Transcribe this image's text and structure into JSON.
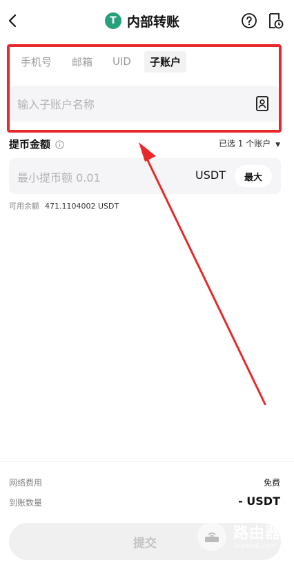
{
  "header": {
    "title": "内部转账",
    "coin_symbol": "T"
  },
  "tabs": [
    {
      "label": "手机号",
      "active": false
    },
    {
      "label": "邮箱",
      "active": false
    },
    {
      "label": "UID",
      "active": false
    },
    {
      "label": "子账户",
      "active": true
    }
  ],
  "subaccount_input": {
    "placeholder": "输入子账户名称"
  },
  "amount": {
    "label": "提币金额",
    "selected_text": "已选 1 个账户",
    "placeholder": "最小提币额 0.01",
    "unit": "USDT",
    "max_label": "最大",
    "available_label": "可用余额",
    "available_value": "471.1104002 USDT"
  },
  "footer": {
    "fee_label": "网络费用",
    "fee_value": "免费",
    "receive_label": "到账数量",
    "receive_value": "- USDT",
    "submit_label": "提交"
  },
  "watermark": {
    "name": "路由器",
    "site": "luyouqi.com"
  },
  "colors": {
    "accent_green": "#26a17b",
    "highlight_red": "#e8292b"
  }
}
